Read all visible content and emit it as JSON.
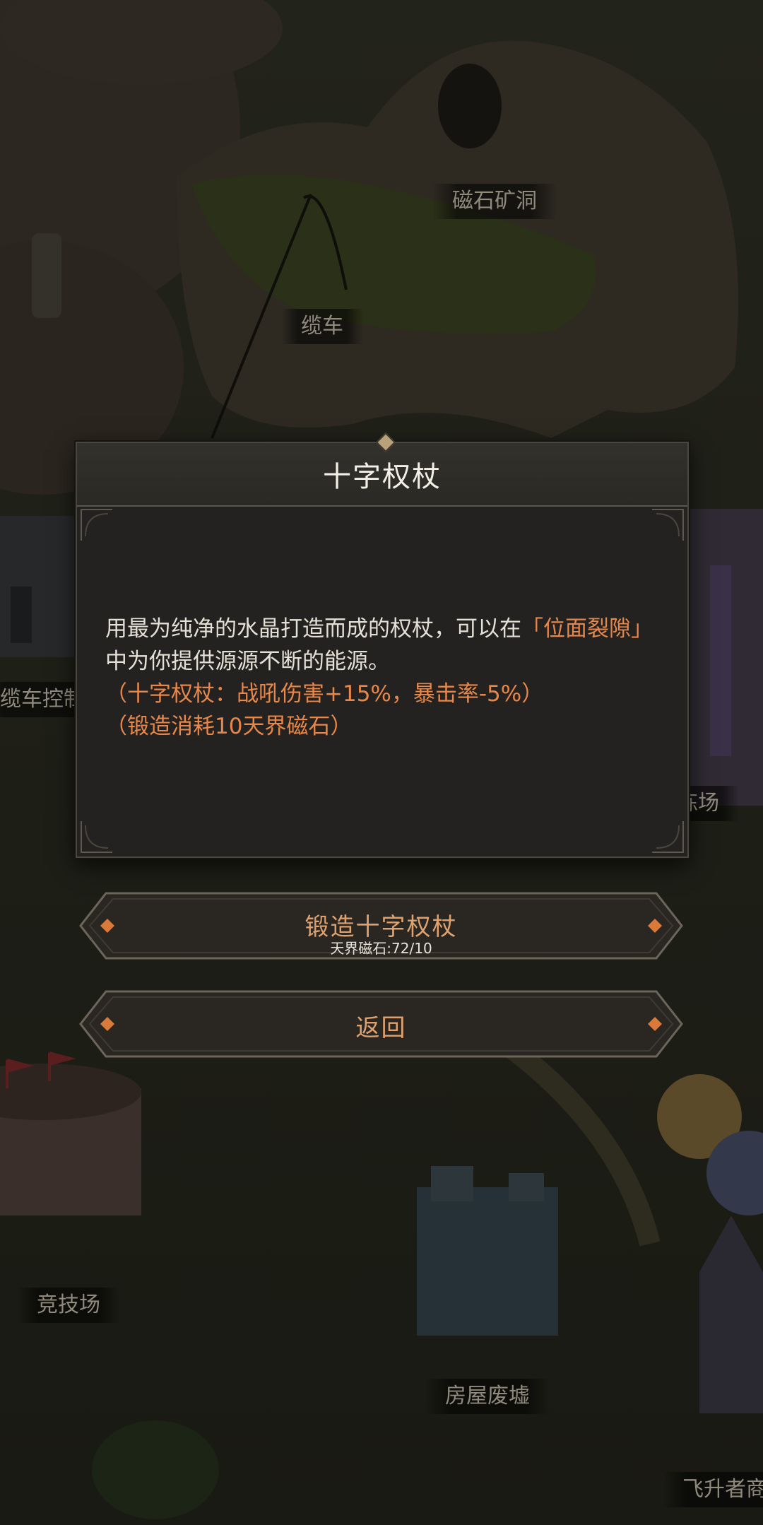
{
  "map": {
    "labels": {
      "magnet_cave": "磁石矿洞",
      "cable_car": "缆车",
      "cable_car_control": "缆车控制",
      "training_ground": "练场",
      "arena": "竞技场",
      "house_ruins": "房屋废墟",
      "ascender_shop": "飞升者商"
    }
  },
  "dialog": {
    "title": "十字权杖",
    "description_part1": "用最为纯净的水晶打造而成的权杖，可以在",
    "highlight": "「位面裂隙」",
    "description_part2": "中为你提供源源不断的能源。",
    "stats": "（十字权杖：战吼伤害+15%，暴击率-5%）",
    "cost": "（锻造消耗10天界磁石）"
  },
  "buttons": {
    "forge_label": "锻造十字权杖",
    "forge_sub": "天界磁石:72/10",
    "back_label": "返回"
  },
  "colors": {
    "accent": "#e8874a",
    "button_text": "#dfa26e",
    "title_text": "#f2efe6"
  }
}
